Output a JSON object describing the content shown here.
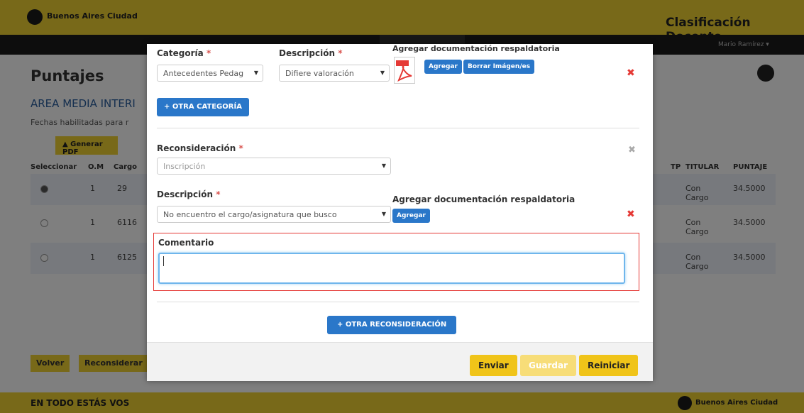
{
  "background": {
    "brand": "Buenos Aires Ciudad",
    "app_title": "Clasificación Docente",
    "nav_right": "Mario Ramírez ▾",
    "page_title": "Puntajes",
    "area": "AREA MEDIA INTERI",
    "fechas": "Fechas habilitadas para r",
    "generar_pdf": "Generar PDF",
    "columns": [
      "Seleccionar",
      "O.M",
      "Cargo",
      "TP",
      "TITULAR",
      "PUNTAJE"
    ],
    "rows": [
      {
        "om": "1",
        "cargo": "29",
        "titular": "Con Cargo",
        "puntaje": "34.5000"
      },
      {
        "om": "1",
        "cargo": "6116",
        "titular": "Con Cargo",
        "puntaje": "34.5000"
      },
      {
        "om": "1",
        "cargo": "6125",
        "titular": "Con Cargo",
        "puntaje": "34.5000"
      }
    ],
    "volver": "Volver",
    "reconsiderar": "Reconsiderar",
    "footer_left": "EN TODO ESTÁS VOS",
    "footer_brand": "Buenos Aires Ciudad"
  },
  "modal": {
    "section1": {
      "categoria_label": "Categoría",
      "categoria_value": "Antecedentes Pedag",
      "descripcion_label": "Descripción",
      "descripcion_value": "Difiere valoración",
      "doc_label": "Agregar documentación respaldatoria",
      "agregar": "Agregar",
      "borrar": "Borrar Imágen/es",
      "otra_categoria": "+ OTRA CATEGORÍA"
    },
    "section2": {
      "reconsideracion_label": "Reconsideración",
      "reconsideracion_value": "Inscripción",
      "descripcion_label": "Descripción",
      "descripcion_value": "No encuentro el cargo/asignatura que busco",
      "doc_label": "Agregar documentación respaldatoria",
      "agregar": "Agregar",
      "comentario_label": "Comentario",
      "comentario_value": ""
    },
    "otra_reconsideracion": "+ OTRA RECONSIDERACIÓN",
    "enviar": "Enviar",
    "guardar": "Guardar",
    "reiniciar": "Reiniciar",
    "required_mark": "*"
  },
  "colors": {
    "yellow": "#f0d232",
    "blue": "#2a77c9",
    "red": "#e53935"
  }
}
